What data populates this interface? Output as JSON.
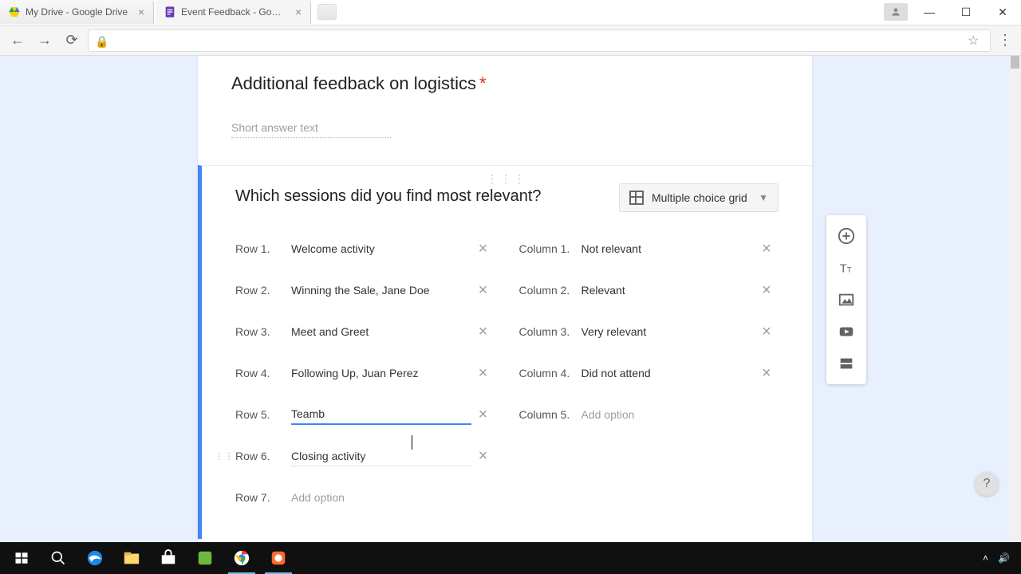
{
  "tabs": [
    {
      "label": "My Drive - Google Drive"
    },
    {
      "label": "Event Feedback - Google"
    }
  ],
  "prev_question": {
    "title": "Additional feedback on logistics",
    "placeholder": "Short answer text"
  },
  "question": {
    "title": "Which sessions did you find most relevant?",
    "type": "Multiple choice grid",
    "rows": [
      {
        "label": "Row 1.",
        "value": "Welcome activity"
      },
      {
        "label": "Row 2.",
        "value": "Winning the Sale, Jane Doe"
      },
      {
        "label": "Row 3.",
        "value": "Meet and Greet"
      },
      {
        "label": "Row 4.",
        "value": "Following Up, Juan Perez"
      },
      {
        "label": "Row 5.",
        "value": "Teamb"
      },
      {
        "label": "Row 6.",
        "value": "Closing activity"
      },
      {
        "label": "Row 7.",
        "value": "Add option"
      }
    ],
    "cols": [
      {
        "label": "Column 1.",
        "value": "Not relevant"
      },
      {
        "label": "Column 2.",
        "value": "Relevant"
      },
      {
        "label": "Column 3.",
        "value": "Very relevant"
      },
      {
        "label": "Column 4.",
        "value": "Did not attend"
      },
      {
        "label": "Column 5.",
        "value": "Add option"
      }
    ]
  }
}
